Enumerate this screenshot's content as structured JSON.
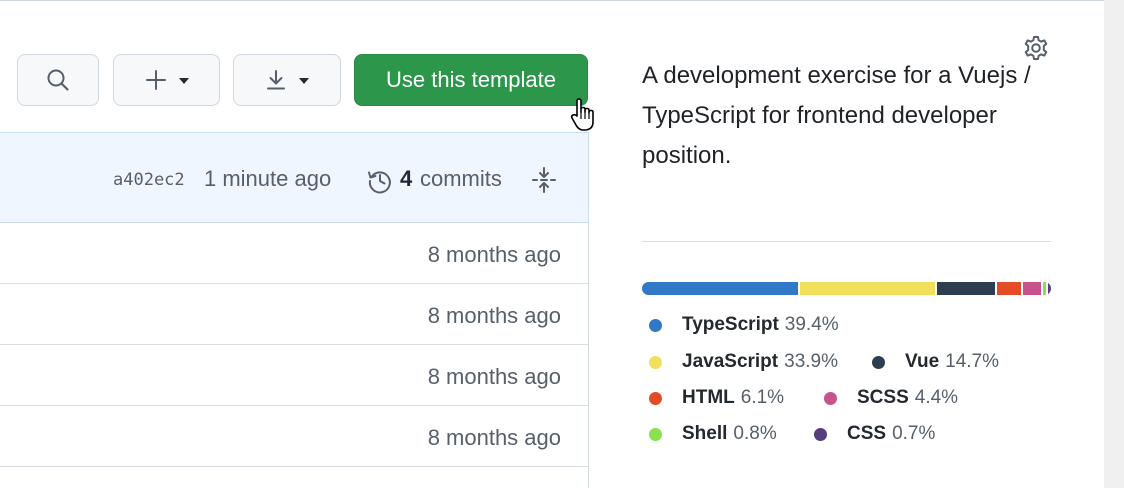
{
  "toolbar": {
    "template_label": "Use this template"
  },
  "commit": {
    "hash": "a402ec2",
    "time": "1 minute ago",
    "count": "4",
    "count_label": "commits"
  },
  "file_rows": [
    {
      "time": "8 months ago"
    },
    {
      "time": "8 months ago"
    },
    {
      "time": "8 months ago"
    },
    {
      "time": "8 months ago"
    }
  ],
  "sidebar": {
    "about": "A development exercise for a Vuejs / TypeScript for frontend developer position.",
    "languages": [
      {
        "name": "TypeScript",
        "percent": "39.4%",
        "value": 39.4,
        "color": "#3178c6"
      },
      {
        "name": "JavaScript",
        "percent": "33.9%",
        "value": 33.9,
        "color": "#f1e05a"
      },
      {
        "name": "Vue",
        "percent": "14.7%",
        "value": 14.7,
        "color": "#2c3e50"
      },
      {
        "name": "HTML",
        "percent": "6.1%",
        "value": 6.1,
        "color": "#e34c26"
      },
      {
        "name": "SCSS",
        "percent": "4.4%",
        "value": 4.4,
        "color": "#c6538c"
      },
      {
        "name": "Shell",
        "percent": "0.8%",
        "value": 0.8,
        "color": "#89e051"
      },
      {
        "name": "CSS",
        "percent": "0.7%",
        "value": 0.7,
        "color": "#563d7c"
      }
    ]
  },
  "icons": {
    "search": "search-icon",
    "plus": "plus-icon",
    "download": "download-icon",
    "history": "history-icon",
    "fold": "fold-icon",
    "gear": "gear-icon",
    "cursor": "hand-pointer-cursor"
  }
}
